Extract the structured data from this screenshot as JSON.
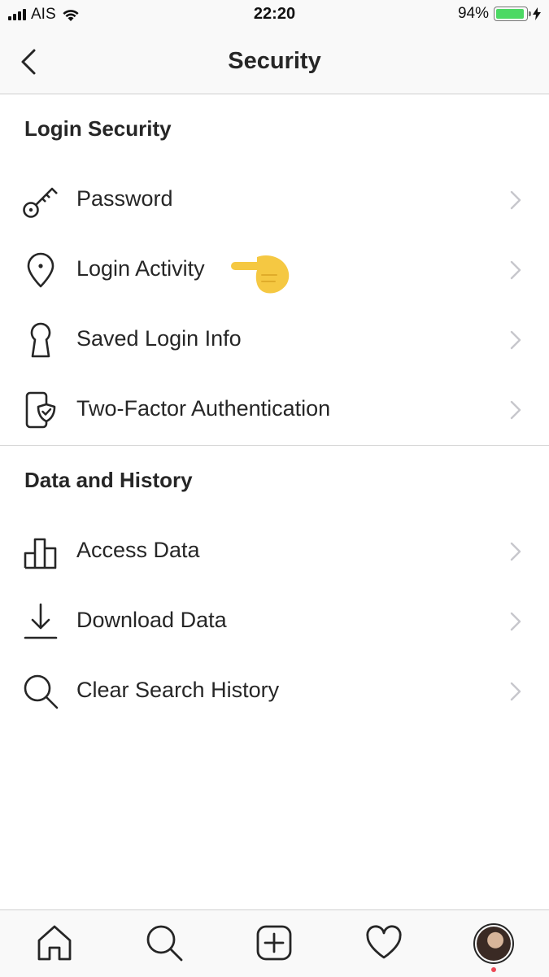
{
  "status_bar": {
    "carrier": "AIS",
    "time": "22:20",
    "battery": "94%",
    "battery_level": 0.94,
    "battery_color": "#4cd964"
  },
  "nav": {
    "title": "Security"
  },
  "sections": [
    {
      "title": "Login Security",
      "items": [
        {
          "label": "Password",
          "icon": "key-icon"
        },
        {
          "label": "Login Activity",
          "icon": "location-pin-icon"
        },
        {
          "label": "Saved Login Info",
          "icon": "keyhole-icon"
        },
        {
          "label": "Two-Factor Authentication",
          "icon": "phone-shield-icon"
        }
      ]
    },
    {
      "title": "Data and History",
      "items": [
        {
          "label": "Access Data",
          "icon": "bar-chart-icon"
        },
        {
          "label": "Download Data",
          "icon": "download-icon"
        },
        {
          "label": "Clear Search History",
          "icon": "search-icon"
        }
      ]
    }
  ],
  "annotation": {
    "emoji": "pointing-hand-icon",
    "color": "#f5c842"
  },
  "tab_bar": {
    "tabs": [
      "home-icon",
      "search-icon",
      "new-post-icon",
      "activity-heart-icon",
      "profile-avatar"
    ],
    "notification_color": "#ed4956"
  }
}
